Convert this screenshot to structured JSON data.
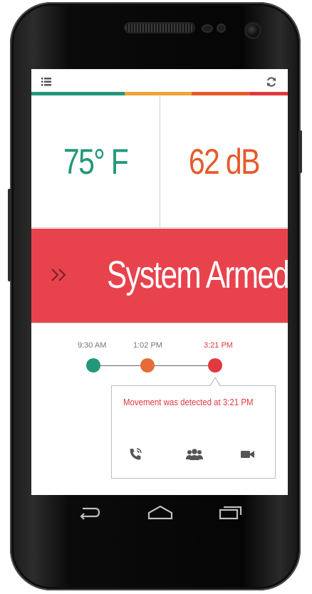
{
  "colors": {
    "teal": "#23977a",
    "orange": "#f0a335",
    "orange_dark": "#e65a2a",
    "red": "#e2383f",
    "armed_bg": "#e8434d",
    "chevron": "#7a2327"
  },
  "topbar": {
    "menu_icon": "list-icon",
    "refresh_icon": "refresh-icon"
  },
  "sensors": {
    "temperature": "75° F",
    "noise": "62 dB"
  },
  "status": {
    "chevron_icon": "double-chevron-right-icon",
    "label": "System Armed"
  },
  "timeline": {
    "events": [
      {
        "time": "9:30 AM",
        "color": "#23977a"
      },
      {
        "time": "1:02 PM",
        "color": "#e66b37"
      },
      {
        "time": "3:21 PM",
        "color": "#e2383f"
      }
    ]
  },
  "alert": {
    "message": "Movement was detected at 3:21 PM",
    "actions": [
      "phone-icon",
      "group-icon",
      "video-camera-icon"
    ]
  },
  "navbar": {
    "back_icon": "back-icon",
    "home_icon": "home-icon",
    "recents_icon": "recents-icon"
  }
}
